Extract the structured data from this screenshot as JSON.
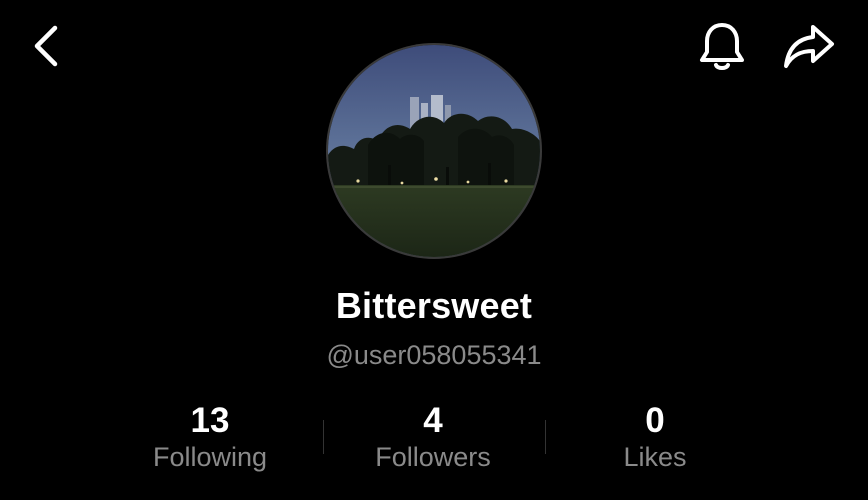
{
  "header": {
    "back_icon": "chevron-left-icon",
    "notification_icon": "bell-icon",
    "share_icon": "share-arrow-icon"
  },
  "profile": {
    "display_name": "Bittersweet",
    "username": "@user058055341",
    "avatar": "night-park-photo"
  },
  "stats": [
    {
      "value": "13",
      "label": "Following"
    },
    {
      "value": "4",
      "label": "Followers"
    },
    {
      "value": "0",
      "label": "Likes"
    }
  ],
  "colors": {
    "background": "#000000",
    "primary_text": "#ffffff",
    "secondary_text": "#8a8a8a",
    "divider": "#333333"
  }
}
